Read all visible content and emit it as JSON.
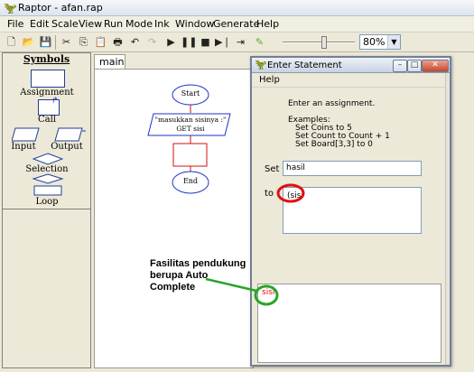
{
  "window": {
    "title": "Raptor - afan.rap"
  },
  "menu": [
    "File",
    "Edit",
    "Scale",
    "View",
    "Run",
    "Mode",
    "Ink",
    "Window",
    "Generate",
    "Help"
  ],
  "toolbar": {
    "zoom_value": "80%",
    "zoom_slider_level": 0.6
  },
  "symbols": {
    "header": "Symbols",
    "items": {
      "assignment": "Assignment",
      "call": "Call",
      "input": "Input",
      "output": "Output",
      "selection": "Selection",
      "loop": "Loop"
    }
  },
  "canvas": {
    "tab": "main",
    "flow": {
      "start": "Start",
      "input_prompt": "\"masukkan sisinya :\"",
      "input_var": "GET sisi",
      "end": "End"
    }
  },
  "dialog": {
    "title": "Enter Statement",
    "menu": "Help",
    "instruction": "Enter an assignment.",
    "examples_header": "Examples:",
    "examples": [
      "Set Coins to 5",
      "Set Count to Count + 1",
      "Set Board[3,3] to 0"
    ],
    "set_label": "Set",
    "set_value": "hasil",
    "to_label": "to",
    "to_value": "(sisi",
    "suggestion": "sisi"
  },
  "annotation": {
    "text": "Fasilitas pendukung\nberupa Auto\nComplete"
  },
  "colors": {
    "annotation_line": "#29a329",
    "highlight_circle": "#e01010",
    "autocomplete_circle": "#2aa52a",
    "flow_blue": "#1a33c8",
    "flow_red": "#d01010"
  }
}
